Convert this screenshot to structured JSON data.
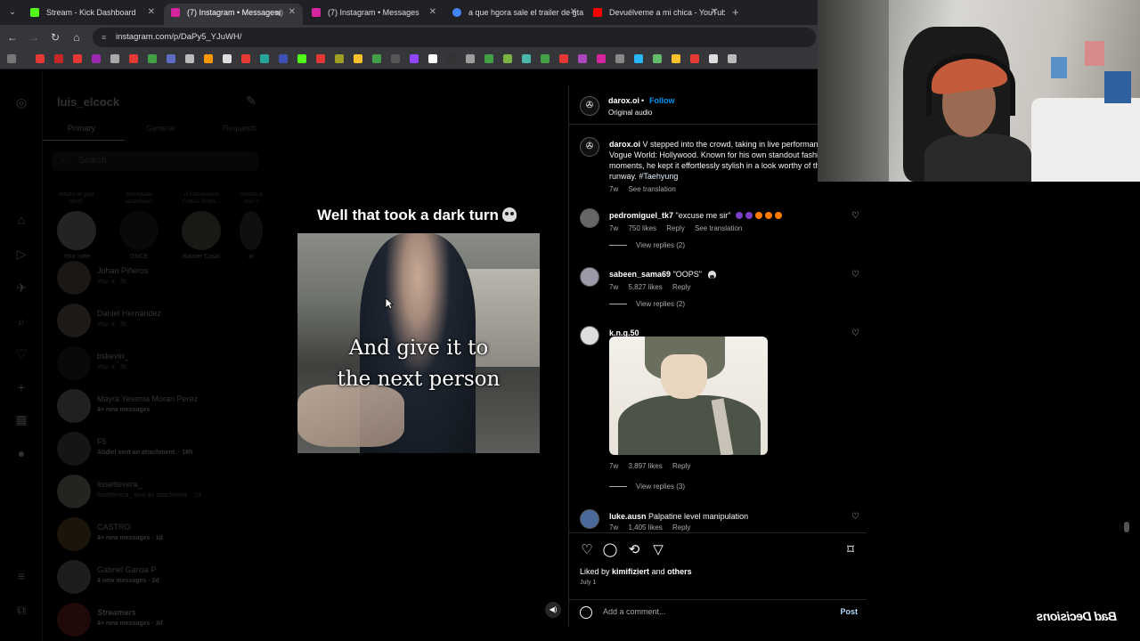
{
  "browser": {
    "tabs": [
      {
        "title": "Stream - Kick Dashboard",
        "color": "#53fc18",
        "active": false
      },
      {
        "title": "(7) Instagram • Messages",
        "color": "#d6249f",
        "active": true
      },
      {
        "title": "(7) Instagram • Messages",
        "color": "#d6249f",
        "active": false
      },
      {
        "title": "a que hgora sale el trailer de gta",
        "color": "#4285f4",
        "active": false
      },
      {
        "title": "Devuélveme a mi chica - YouTube",
        "color": "#ff0000",
        "active": false
      }
    ],
    "url": "instagram.com/p/DaPy5_YJuWH/"
  },
  "dm": {
    "username": "luis_elcock",
    "tabs": [
      "Primary",
      "General",
      "Requests"
    ],
    "search_placeholder": "Search",
    "notes": [
      {
        "bubble": "What's on your mind?",
        "name": "Your note"
      },
      {
        "bubble": "Mis/master accesibles?",
        "name": "ONCE"
      },
      {
        "bubble": "lil Camanance Cultura Profes...",
        "name": "Rainier Casal"
      },
      {
        "bubble": "uniclub q mas v",
        "name": "al"
      }
    ],
    "conversations": [
      {
        "name": "Johan Piñeros",
        "sub": "You: a · 3h",
        "unread": false
      },
      {
        "name": "Daniel Hernández",
        "sub": "You: a · 3h",
        "unread": false
      },
      {
        "name": "bskevin_",
        "sub": "You: a · 3h",
        "unread": false
      },
      {
        "name": "Mayra Yesenia Moran Perez",
        "sub": "4+ new messages",
        "unread": true
      },
      {
        "name": "F5",
        "sub": "Abdiel sent an attachment. · 18h",
        "unread": true
      },
      {
        "name": "lissettevera_",
        "sub": "lissettevera_ sent an attachment. · 1d",
        "unread": false
      },
      {
        "name": "CASTRO",
        "sub": "4+ new messages · 1d",
        "unread": true
      },
      {
        "name": "Gabriel Garcia P",
        "sub": "4 new messages · 2d",
        "unread": true
      },
      {
        "name": "Streamers",
        "sub": "4+ new messages · 3d",
        "unread": true
      }
    ]
  },
  "post": {
    "caption_text": "Well that took a dark turn",
    "video_subtitle": "And give it to\nthe next person",
    "author": "darox.oi",
    "follow_label": "Follow",
    "dot": "•",
    "audio": "Original audio",
    "description": {
      "user": "darox.oi",
      "text": "V stepped into the crowd, taking in live performances at Vogue World: Hollywood. Known for his own standout fashion moments, he kept it effortlessly stylish in a look worthy of the runway.",
      "hashtag": "#Taehyung",
      "time": "7w",
      "see_translation": "See translation"
    },
    "comments": [
      {
        "user": "pedromiguel_tk7",
        "text": "\"excuse me sir\"",
        "time": "7w",
        "likes": "750 likes",
        "reply": "Reply",
        "extra": "See translation",
        "view_replies": "View replies (2)"
      },
      {
        "user": "sabeen_sama69",
        "text": "\"OOPS\"",
        "time": "7w",
        "likes": "5,827 likes",
        "reply": "Reply",
        "extra": "",
        "view_replies": "View replies (2)"
      },
      {
        "user": "k.n.g.50",
        "text": "",
        "time": "7w",
        "likes": "3,897 likes",
        "reply": "Reply",
        "extra": "",
        "view_replies": "View replies (3)"
      },
      {
        "user": "luke.ausn",
        "text": "Palpatine level manipulation",
        "time": "7w",
        "likes": "1,405 likes",
        "reply": "Reply",
        "extra": "",
        "view_replies": ""
      }
    ],
    "liked_prefix": "Liked by",
    "liked_user": "kimifiziert",
    "liked_and": "and",
    "liked_others": "others",
    "date": "July 1",
    "add_comment_placeholder": "Add a comment...",
    "post_button": "Post"
  },
  "watermark": "Bad Decisions",
  "colors": {
    "accent": "#0095f6",
    "bg": "#000000",
    "chrome": "#35363a"
  }
}
